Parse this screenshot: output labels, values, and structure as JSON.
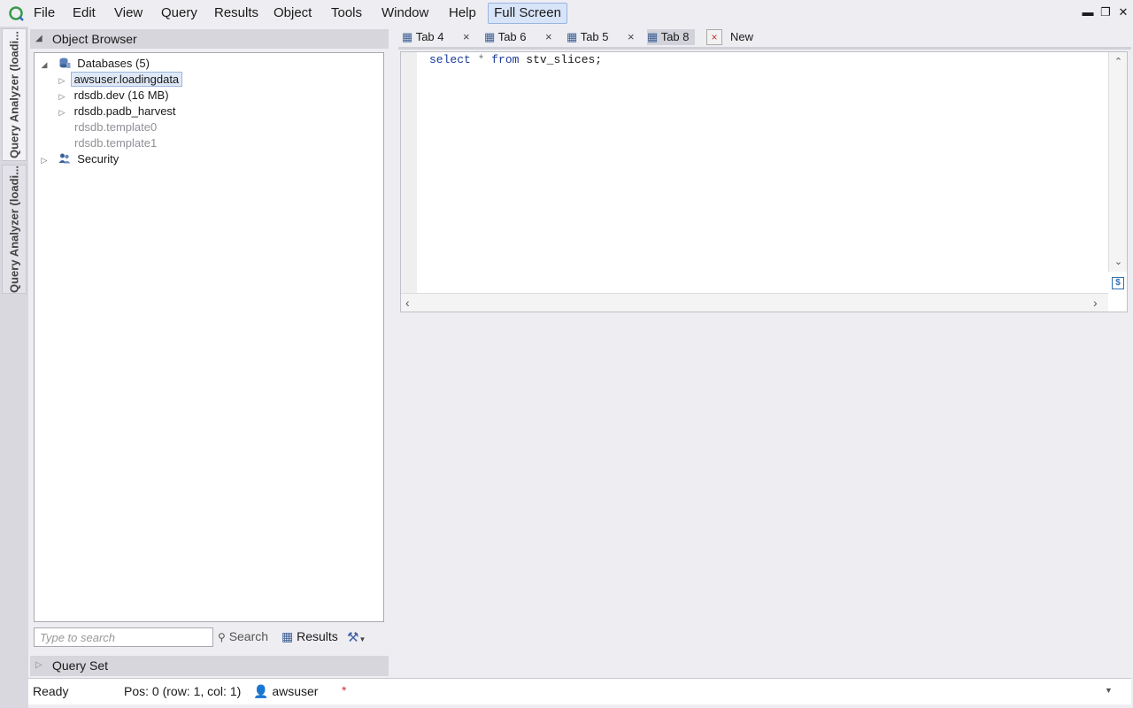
{
  "menu": {
    "items": [
      "File",
      "Edit",
      "View",
      "Query",
      "Results",
      "Object",
      "Tools",
      "Window",
      "Help"
    ],
    "fullscreen_label": "Full Screen"
  },
  "vertical_tabs": [
    "Query Analyzer (loadi...",
    "Query Analyzer (loadi..."
  ],
  "object_browser": {
    "title": "Object Browser",
    "tree": {
      "databases_label": "Databases (5)",
      "db1": "awsuser.loadingdata",
      "db2": "rdsdb.dev (16 MB)",
      "db3": "rdsdb.padb_harvest",
      "db4": "rdsdb.template0",
      "db5": "rdsdb.template1",
      "security": "Security"
    },
    "search_placeholder": "Type to search",
    "search_label": "Search",
    "results_label": "Results"
  },
  "query_set_label": "Query Set",
  "tabs": {
    "t1": "Tab 4",
    "t2": "Tab 6",
    "t3": "Tab 5",
    "t4": "Tab 8",
    "new": "New",
    "close": "×"
  },
  "editor": {
    "kw_select": "select",
    "star": "*",
    "kw_from": "from",
    "table": "stv_slices;"
  },
  "status": {
    "ready": "Ready",
    "position": "Pos: 0 (row: 1, col: 1)",
    "user": "awsuser",
    "dirty": "*"
  }
}
